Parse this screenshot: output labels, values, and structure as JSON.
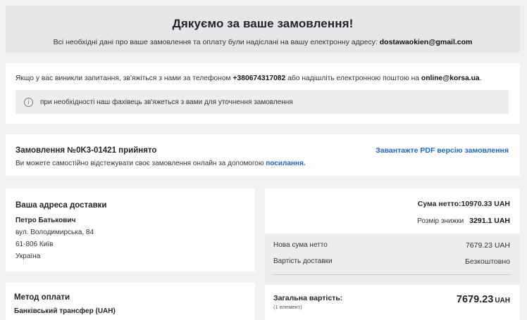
{
  "hero": {
    "title": "Дякуємо за ваше замовлення!",
    "text": "Всі необхідні дані про ваше замовлення та оплату були надіслані на вашу електронну адресу:",
    "email": "dostawaokien@gmail.com"
  },
  "contact": {
    "text1": "Якщо у вас виникли запитання, зв'яжіться з нами за телефоном",
    "phone": "+380674317082",
    "text2": "або надішліть електронною поштою на",
    "email": "online@korsa.ua",
    "text3": ".",
    "note": "при необхідності наш фахівець зв'яжеться з вами для уточнення замовлення",
    "note_icon": "info-icon"
  },
  "order": {
    "title": "Замовлення №0K3-01421 прийнято",
    "sub_text": "Ви можете самостійно відстежувати своє замовлення онлайн за допомогою",
    "sub_link": "посилання.",
    "pdf_link": "Завантажте PDF версію замовлення"
  },
  "address": {
    "heading": "Ваша адреса доставки",
    "name": "Петро Батькович",
    "street": "вул. Володимирська, 84",
    "city": "61-806 Київ",
    "country": "Україна"
  },
  "payment": {
    "heading": "Метод оплати",
    "value": "Банківський трансфер (UAH)"
  },
  "summary": {
    "net_label": "Сума нетто:",
    "net_value": "10970.33 UAH",
    "discount_label": "Розмір знижки",
    "discount_value": "3291.1 UAH",
    "new_net_label": "Нова сума нетто",
    "new_net_value": "7679.23 UAH",
    "shipping_label": "Вартість доставки",
    "shipping_value": "Безкоштовно",
    "total_label": "Загальна вартість:",
    "total_sub": "(1 елемент)",
    "total_value": "7679.23",
    "total_currency": "UAH"
  },
  "colors": {
    "link": "#1a67c4",
    "page_bg": "#f1f1f3",
    "panel_bg": "#ffffff",
    "grey_block": "#ededef"
  }
}
